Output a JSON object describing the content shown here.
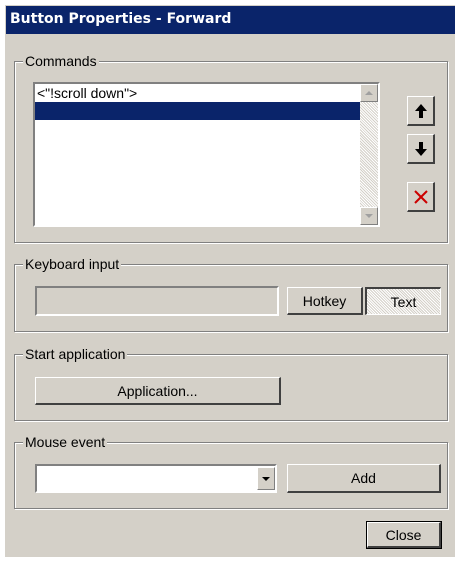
{
  "window": {
    "title": "Button Properties - Forward"
  },
  "commands": {
    "label": "Commands",
    "items": [
      {
        "text": "<\"!scroll down\">"
      },
      {
        "text": ""
      }
    ],
    "move_up_icon": "arrow-up-icon",
    "move_down_icon": "arrow-down-icon",
    "delete_icon": "delete-x-icon",
    "delete_color": "#cc0000"
  },
  "keyboard": {
    "label": "Keyboard input",
    "input_value": "",
    "hotkey_label": "Hotkey",
    "text_label": "Text"
  },
  "start_application": {
    "label": "Start application",
    "application_label": "Application..."
  },
  "mouse_event": {
    "label": "Mouse event",
    "selected_value": "",
    "add_label": "Add"
  },
  "footer": {
    "close_label": "Close"
  },
  "colors": {
    "title_bar": "#0a246a",
    "face": "#d4d0c8",
    "selection": "#0a246a"
  }
}
